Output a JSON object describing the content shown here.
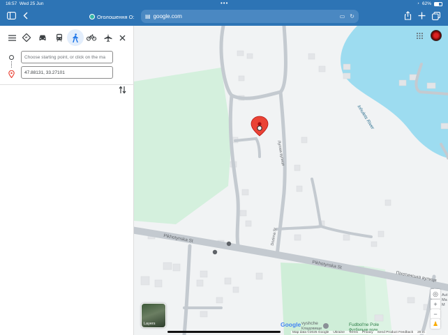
{
  "status": {
    "time": "16:57",
    "date": "Wed 25 Jun",
    "battery": "62%"
  },
  "browser": {
    "tab_title": "Оголошення О:",
    "url": "google.com"
  },
  "directions": {
    "start_placeholder": "Choose starting point, or click on the ma",
    "destination_value": "47.88131, 33.27101",
    "active_mode": "walking"
  },
  "map": {
    "labels": {
      "river": "Inhulets River",
      "street1": "Pikhotynska St",
      "street2": "Pikhotynska St",
      "street3": "Пiхотинська вулиця",
      "street4": "Лугова вулиця",
      "street5": "Dozirna St",
      "place1": "Кладовище",
      "place2": "Fudbol'ne Pole",
      "place3": "Футбольне поле",
      "place_vysh": "vyshche",
      "side_auto": "Aut",
      "side_ma": "Ma",
      "side_m": "M"
    },
    "layers_label": "Layers",
    "google_logo": "Google",
    "attribution": {
      "map_data": "Map data ©2025 Google",
      "country": "Ukraine",
      "terms": "Terms",
      "privacy": "Privacy",
      "feedback": "Send Product Feedback",
      "scale": "20 m"
    }
  },
  "colors": {
    "safari": "#2d74b5",
    "river": "#9ddcf0",
    "park": "#d4f0dd",
    "road": "#c4cad0",
    "pin": "#ea4335",
    "accent": "#1a73e8"
  }
}
